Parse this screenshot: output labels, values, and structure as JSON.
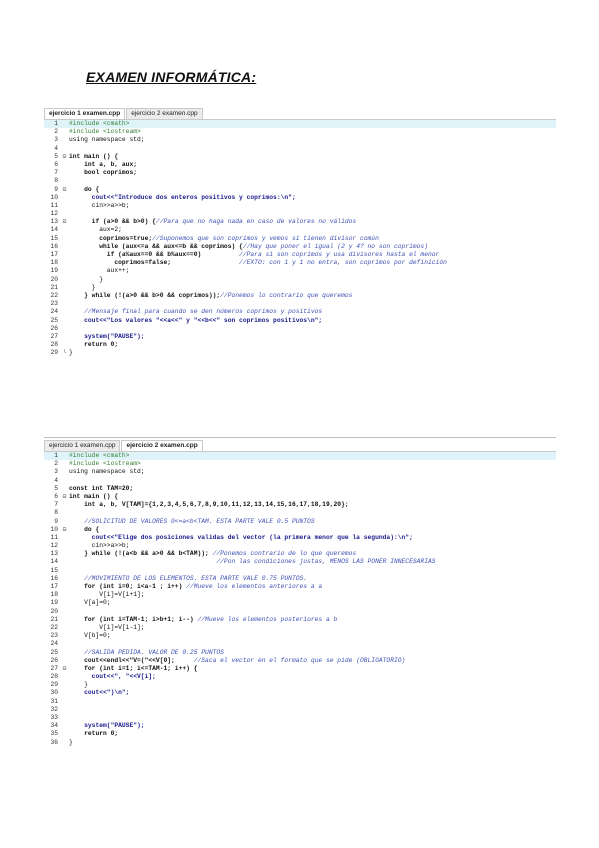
{
  "title": "EXAMEN INFORMÁTICA:",
  "editor1": {
    "tabs": [
      "ejercicio 1 examen.cpp",
      "ejercicio 2 examen.cpp"
    ],
    "active_tab": 0,
    "lines": [
      {
        "n": "1",
        "fold": "",
        "text": "#include <cmath>",
        "type": "pre",
        "hl": true
      },
      {
        "n": "2",
        "fold": "",
        "text": "#include <iostream>",
        "type": "pre"
      },
      {
        "n": "3",
        "fold": "",
        "text": "using namespace std;",
        "type": "code"
      },
      {
        "n": "4",
        "fold": "",
        "text": "",
        "type": "code"
      },
      {
        "n": "5",
        "fold": "⊟",
        "text": "int main () {",
        "type": "kw"
      },
      {
        "n": "6",
        "fold": "",
        "text": "    int a, b, aux;",
        "type": "kw"
      },
      {
        "n": "7",
        "fold": "",
        "text": "    bool coprimos;",
        "type": "kw"
      },
      {
        "n": "8",
        "fold": "",
        "text": "",
        "type": "code"
      },
      {
        "n": "9",
        "fold": "⊟",
        "text": "    do {",
        "type": "kw"
      },
      {
        "n": "10",
        "fold": "",
        "text": "      cout<<\"Introduce dos enteros positivos y coprimos:\\n\";",
        "type": "str"
      },
      {
        "n": "11",
        "fold": "",
        "text": "      cin>>a>>b;",
        "type": "code"
      },
      {
        "n": "12",
        "fold": "",
        "text": "",
        "type": "code"
      },
      {
        "n": "13",
        "fold": "⊟",
        "text": "      if (a>0 && b>0) {//Para que no haga nada en caso de valores no válidos",
        "type": "cmt"
      },
      {
        "n": "14",
        "fold": "",
        "text": "        aux=2;",
        "type": "code"
      },
      {
        "n": "15",
        "fold": "",
        "text": "        coprimos=true;//Suponemos que son coprimos y vemos si tienen divisor común",
        "type": "cmt"
      },
      {
        "n": "16",
        "fold": "",
        "text": "        while (aux<=a && aux<=b && coprimos) {//Hay que poner el igual (2 y 4? no son coprimos)",
        "type": "cmt"
      },
      {
        "n": "17",
        "fold": "",
        "text": "          if (a%aux==0 && b%aux==0)          //Para si son coprimos y usa divisores hasta el menor",
        "type": "cmt"
      },
      {
        "n": "18",
        "fold": "",
        "text": "            coprimos=false;                  //EXTO: con 1 y 1 no entra, son coprimos por definición",
        "type": "cmt"
      },
      {
        "n": "19",
        "fold": "",
        "text": "          aux++;",
        "type": "code"
      },
      {
        "n": "20",
        "fold": "",
        "text": "        }",
        "type": "code"
      },
      {
        "n": "21",
        "fold": "",
        "text": "      }",
        "type": "code"
      },
      {
        "n": "22",
        "fold": "",
        "text": "    } while (!(a>0 && b>0 && coprimos));//Ponemos lo contrario que queremos",
        "type": "cmt"
      },
      {
        "n": "23",
        "fold": "",
        "text": "",
        "type": "code"
      },
      {
        "n": "24",
        "fold": "",
        "text": "    //Mensaje final para cuando se den números coprimos y positivos",
        "type": "cmtline"
      },
      {
        "n": "25",
        "fold": "",
        "text": "    cout<<\"Los valores \"<<a<<\" y \"<<b<<\" son coprimos positivos\\n\";",
        "type": "str"
      },
      {
        "n": "26",
        "fold": "",
        "text": "",
        "type": "code"
      },
      {
        "n": "27",
        "fold": "",
        "text": "    system(\"PAUSE\");",
        "type": "str"
      },
      {
        "n": "28",
        "fold": "",
        "text": "    return 0;",
        "type": "kw"
      },
      {
        "n": "29",
        "fold": "└",
        "text": "}",
        "type": "code"
      }
    ]
  },
  "editor2": {
    "tabs": [
      "ejercicio 1 examen.cpp",
      "ejercicio 2 examen.cpp"
    ],
    "active_tab": 1,
    "lines": [
      {
        "n": "1",
        "fold": "",
        "text": "#include <cmath>",
        "type": "pre",
        "hl": true
      },
      {
        "n": "2",
        "fold": "",
        "text": "#include <iostream>",
        "type": "pre"
      },
      {
        "n": "3",
        "fold": "",
        "text": "using namespace std;",
        "type": "code"
      },
      {
        "n": "4",
        "fold": "",
        "text": "",
        "type": "code"
      },
      {
        "n": "5",
        "fold": "",
        "text": "const int TAM=20;",
        "type": "kw"
      },
      {
        "n": "6",
        "fold": "⊟",
        "text": "int main () {",
        "type": "kw"
      },
      {
        "n": "7",
        "fold": "",
        "text": "    int a, b, V[TAM]={1,2,3,4,5,6,7,8,9,10,11,12,13,14,15,16,17,18,19,20};",
        "type": "kw"
      },
      {
        "n": "8",
        "fold": "",
        "text": "",
        "type": "code"
      },
      {
        "n": "9",
        "fold": "",
        "text": "    //SOLICITUD DE VALORES 0<=a<b<TAM. ESTA PARTE VALE 0.5 PUNTOS",
        "type": "cmtline"
      },
      {
        "n": "10",
        "fold": "⊟",
        "text": "    do {",
        "type": "kw"
      },
      {
        "n": "11",
        "fold": "",
        "text": "      cout<<\"Elige dos posiciones validas del vector (la primera menor que la segunda):\\n\";",
        "type": "str"
      },
      {
        "n": "12",
        "fold": "",
        "text": "      cin>>a>>b;",
        "type": "code"
      },
      {
        "n": "13",
        "fold": "",
        "text": "    } while (!(a<b && a>0 && b<TAM)); //Ponemos contrario de lo que queremos",
        "type": "cmt"
      },
      {
        "n": "14",
        "fold": "",
        "text": "                                       //Pon las condiciones justas, MENOS LAS PONER INNECESARIAS",
        "type": "cmtline"
      },
      {
        "n": "15",
        "fold": "",
        "text": "",
        "type": "code"
      },
      {
        "n": "16",
        "fold": "",
        "text": "    //MOVIMIENTO DE LOS ELEMENTOS. ESTA PARTE VALE 0.75 PUNTOS.",
        "type": "cmtline"
      },
      {
        "n": "17",
        "fold": "",
        "text": "    for (int i=0; i<a-1 ; i++) //Mueve los elementos anteriores a a",
        "type": "cmt"
      },
      {
        "n": "18",
        "fold": "",
        "text": "        V[i]=V[i+1];",
        "type": "code"
      },
      {
        "n": "19",
        "fold": "",
        "text": "    V[a]=0;",
        "type": "code"
      },
      {
        "n": "20",
        "fold": "",
        "text": "",
        "type": "code"
      },
      {
        "n": "21",
        "fold": "",
        "text": "    for (int i=TAM-1; i>b+1; i--) //Mueve los elementos posteriores a b",
        "type": "cmt"
      },
      {
        "n": "22",
        "fold": "",
        "text": "        V[i]=V[i-1];",
        "type": "code"
      },
      {
        "n": "23",
        "fold": "",
        "text": "    V[b]=0;",
        "type": "code"
      },
      {
        "n": "24",
        "fold": "",
        "text": "",
        "type": "code"
      },
      {
        "n": "25",
        "fold": "",
        "text": "    //SALIDA PEDIDA. VALOR DE 0.25 PUNTOS",
        "type": "cmtline"
      },
      {
        "n": "26",
        "fold": "",
        "text": "    cout<<endl<<\"V=(\"<<V[0];     //Saca el vector en el formato que se pide (OBLIGATORIO)",
        "type": "cmt"
      },
      {
        "n": "27",
        "fold": "⊟",
        "text": "    for (int i=1; i<=TAM-1; i++) {",
        "type": "kw"
      },
      {
        "n": "28",
        "fold": "",
        "text": "      cout<<\", \"<<V[i];",
        "type": "str"
      },
      {
        "n": "29",
        "fold": "",
        "text": "    }",
        "type": "code"
      },
      {
        "n": "30",
        "fold": "",
        "text": "    cout<<\")\\n\";",
        "type": "str"
      },
      {
        "n": "31",
        "fold": "",
        "text": "",
        "type": "code"
      },
      {
        "n": "32",
        "fold": "",
        "text": "",
        "type": "code"
      },
      {
        "n": "33",
        "fold": "",
        "text": "",
        "type": "code"
      },
      {
        "n": "34",
        "fold": "",
        "text": "    system(\"PAUSE\");",
        "type": "str"
      },
      {
        "n": "35",
        "fold": "",
        "text": "    return 0;",
        "type": "kw"
      },
      {
        "n": "36",
        "fold": "",
        "text": "}",
        "type": "code"
      }
    ]
  }
}
